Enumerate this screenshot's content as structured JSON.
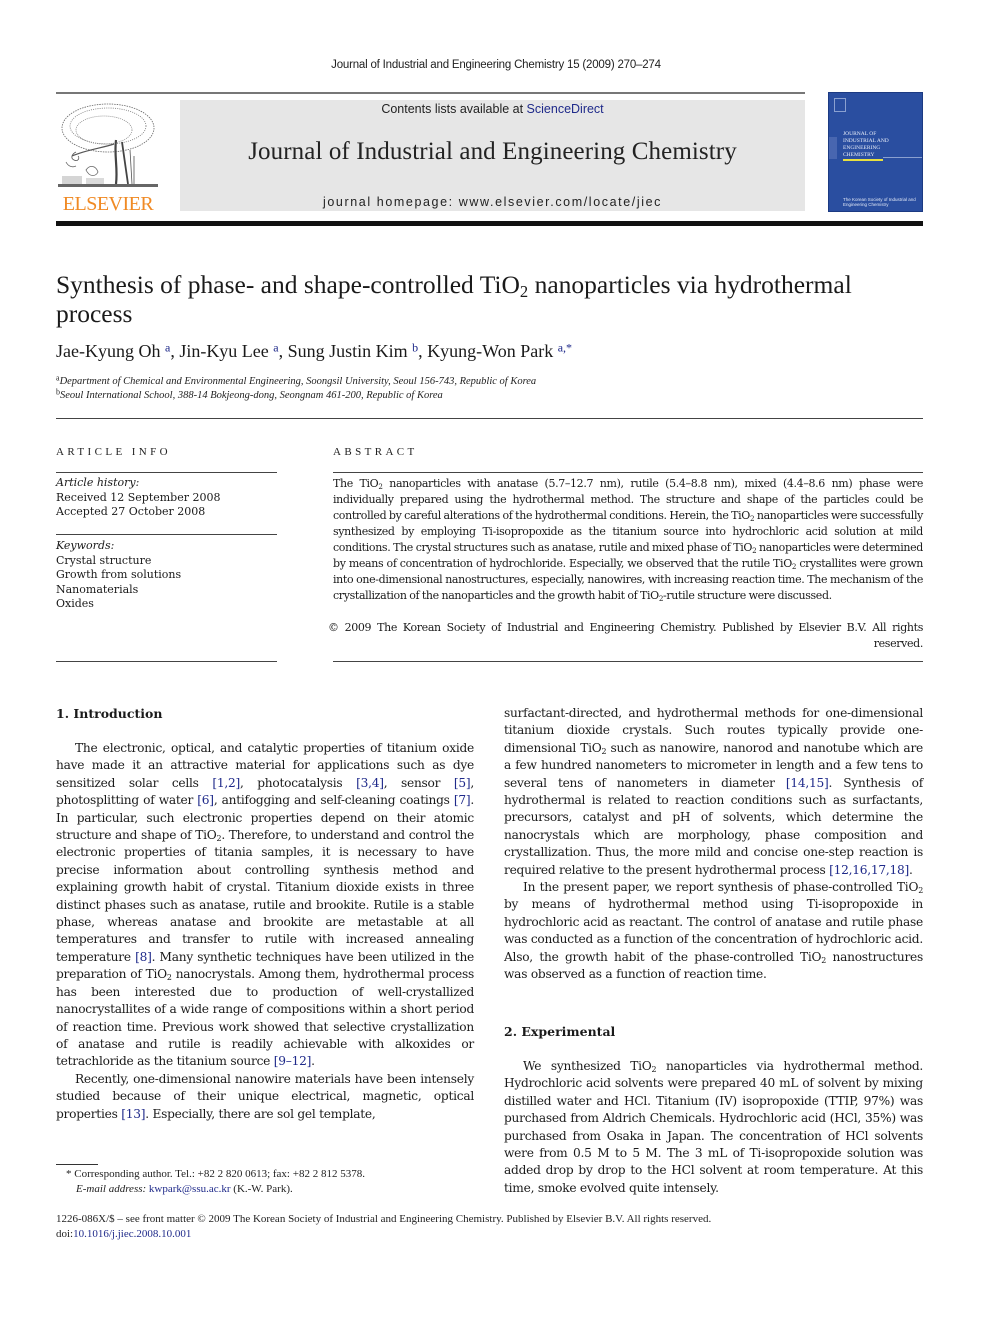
{
  "running_head": "Journal of Industrial and Engineering Chemistry 15 (2009) 270–274",
  "masthead": {
    "publisher_logo_text": "ELSEVIER",
    "contents_prefix": "Contents lists available at ",
    "contents_link": "ScienceDirect",
    "journal_title": "Journal of Industrial and Engineering Chemistry",
    "homepage": "journal homepage: www.elsevier.com/locate/jiec",
    "cover_title_lines": [
      "Journal of",
      "Industrial and",
      "Engineering",
      "Chemistry"
    ],
    "cover_publisher": "The Korean Society of Industrial and Engineering Chemistry",
    "colors": {
      "elsevier_orange": "#f08a24",
      "cover_blue": "#2a4ea0",
      "link_blue": "#1f2a8a",
      "masthead_gray": "#e6e6e6"
    }
  },
  "article": {
    "title_part1": "Synthesis of phase- and shape-controlled TiO",
    "title_sub": "2",
    "title_part2": " nanoparticles via hydrothermal process",
    "authors": [
      {
        "name": "Jae-Kyung Oh",
        "aff": "a"
      },
      {
        "name": "Jin-Kyu Lee",
        "aff": "a"
      },
      {
        "name": "Sung Justin Kim",
        "aff": "b"
      },
      {
        "name": "Kyung-Won Park",
        "aff": "a,*"
      }
    ],
    "affiliations": [
      {
        "mark": "a",
        "text": "Department of Chemical and Environmental Engineering, Soongsil University, Seoul 156-743, Republic of Korea"
      },
      {
        "mark": "b",
        "text": "Seoul International School, 388-14 Bokjeong-dong, Seongnam 461-200, Republic of Korea"
      }
    ]
  },
  "article_info": {
    "heading": "ARTICLE INFO",
    "history_label": "Article history:",
    "received": "Received 12 September 2008",
    "accepted": "Accepted 27 October 2008",
    "keywords_label": "Keywords:",
    "keywords": [
      "Crystal structure",
      "Growth from solutions",
      "Nanomaterials",
      "Oxides"
    ]
  },
  "abstract": {
    "heading": "ABSTRACT",
    "segments": [
      "The TiO",
      "2",
      " nanoparticles with anatase (5.7–12.7 nm), rutile (5.4–8.8 nm), mixed (4.4–8.6 nm) phase were individually prepared using the hydrothermal method. The structure and shape of the particles could be controlled by careful alterations of the hydrothermal conditions. Herein, the TiO",
      "2",
      " nanoparticles were successfully synthesized by employing Ti-isopropoxide as the titanium source into hydrochloric acid solution at mild conditions. The crystal structures such as anatase, rutile and mixed phase of TiO",
      "2",
      " nanoparticles were determined by means of concentration of hydrochloride. Especially, we observed that the rutile TiO",
      "2",
      " crystallites were grown into one-dimensional nanostructures, especially, nanowires, with increasing reaction time. The mechanism of the crystallization of the nanoparticles and the growth habit of TiO",
      "2",
      "-rutile structure were discussed."
    ],
    "copyright": "© 2009 The Korean Society of Industrial and Engineering Chemistry. Published by Elsevier B.V. All rights reserved."
  },
  "sections": {
    "introduction": {
      "heading": "1.  Introduction",
      "p1": [
        {
          "t": "The electronic, optical, and catalytic properties of titanium oxide have made it an attractive material for applications such as dye sensitized solar cells "
        },
        {
          "ref": "[1,2]"
        },
        {
          "t": ", photocatalysis "
        },
        {
          "ref": "[3,4]"
        },
        {
          "t": ", sensor "
        },
        {
          "ref": "[5]"
        },
        {
          "t": ", photosplitting of water "
        },
        {
          "ref": "[6]"
        },
        {
          "t": ", antifogging and self-cleaning coatings "
        },
        {
          "ref": "[7]"
        },
        {
          "t": ". In particular, such electronic properties depend on their atomic structure and shape of TiO"
        },
        {
          "sub": "2"
        },
        {
          "t": ". Therefore, to understand and control the electronic properties of titania samples, it is necessary to have precise information about controlling synthesis method and explaining growth habit of crystal. Titanium dioxide exists in three distinct phases such as anatase, rutile and brookite. Rutile is a stable phase, whereas anatase and brookite are metastable at all temperatures and transfer to rutile with increased annealing temperature "
        },
        {
          "ref": "[8]"
        },
        {
          "t": ". Many synthetic techniques have been utilized in the preparation of TiO"
        },
        {
          "sub": "2"
        },
        {
          "t": " nanocrystals. Among them, hydrothermal process has been interested due to production of well-crystallized nanocrystallites of a wide range of compositions within a short period of reaction time. Previous work showed that selective crystallization of anatase and rutile is readily achievable with alkoxides or tetrachloride as the titanium source "
        },
        {
          "ref": "[9–12]"
        },
        {
          "t": "."
        }
      ],
      "p2": [
        {
          "t": "Recently, one-dimensional nanowire materials have been intensely studied because of their unique electrical, magnetic, optical properties "
        },
        {
          "ref": "[13]"
        },
        {
          "t": ". Especially, there are sol gel template, surfactant-directed, and hydrothermal methods for one-dimensional titanium dioxide crystals. Such routes typically provide one-dimensional TiO"
        },
        {
          "sub": "2"
        },
        {
          "t": " such as nanowire, nanorod and nanotube which are a few hundred nanometers to micrometer in length and a few tens to several tens of nanometers in diameter "
        },
        {
          "ref": "[14,15]"
        },
        {
          "t": ". Synthesis of hydrothermal is related to reaction conditions such as surfactants, precursors, catalyst and pH of solvents, which determine the nanocrystals which are morphology, phase composition and crystallization. Thus, the more mild and concise one-step reaction is required relative to the present hydrothermal process "
        },
        {
          "ref": "[12,16,17,18]"
        },
        {
          "t": "."
        }
      ],
      "p3": [
        {
          "t": "In the present paper, we report synthesis of phase-controlled TiO"
        },
        {
          "sub": "2"
        },
        {
          "t": " by means of hydrothermal method using Ti-isopropoxide in hydrochloric acid as reactant. The control of anatase and rutile phase was conducted as a function of the concentration of hydrochloric acid. Also, the growth habit of the phase-controlled TiO"
        },
        {
          "sub": "2"
        },
        {
          "t": " nanostructures was observed as a function of reaction time."
        }
      ]
    },
    "experimental": {
      "heading": "2.  Experimental",
      "p1": [
        {
          "t": "We synthesized TiO"
        },
        {
          "sub": "2"
        },
        {
          "t": " nanoparticles via hydrothermal method. Hydrochloric acid solvents were prepared 40 mL of solvent by mixing distilled water and HCl. Titanium (IV) isopropoxide (TTIP, 97%) was purchased from Aldrich Chemicals. Hydrochloric acid (HCl, 35%) was purchased from Osaka in Japan. The concentration of HCl solvents were from 0.5 M to 5 M. The 3 mL of Ti-isopropoxide solution was added drop by drop to the HCl solvent at room temperature. At this time, smoke evolved quite intensely."
        }
      ]
    }
  },
  "footnote": {
    "corresponding": "* Corresponding author. Tel.: +82 2 820 0613; fax: +82 2 812 5378.",
    "email_label": "E-mail address:",
    "email": "kwpark@ssu.ac.kr",
    "email_suffix": " (K.-W. Park)."
  },
  "front_matter": {
    "issn_line": "1226-086X/$ – see front matter © 2009 The Korean Society of Industrial and Engineering Chemistry. Published by Elsevier B.V. All rights reserved.",
    "doi_prefix": "doi:",
    "doi": "10.1016/j.jiec.2008.10.001"
  }
}
